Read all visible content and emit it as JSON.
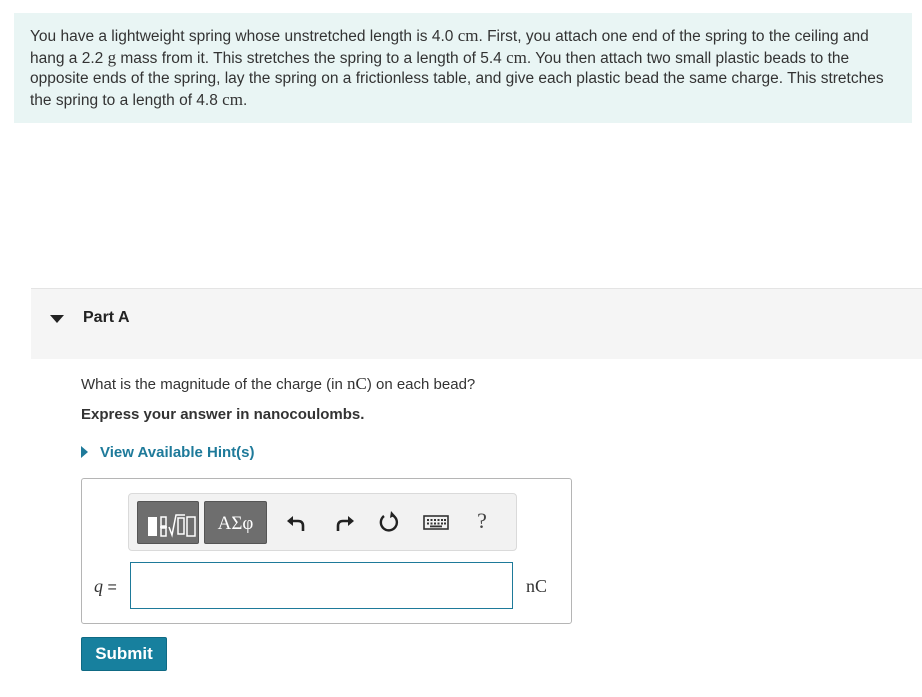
{
  "problem": {
    "s1": "You have a lightweight spring whose unstretched length is 4.0",
    "u1": "cm",
    "s2": ". First, you attach one end of the spring to the ceiling",
    "s3": "and hang a 2.2",
    "u2": "g",
    "s4": "mass from it. This stretches the spring to a length of 5.4",
    "u3": "cm",
    "s5": ". You then attach two small plastic beads",
    "s6": "to the opposite ends of the spring, lay the spring on a frictionless table, and give each plastic bead the same charge.",
    "s7": "This stretches the spring to a length of 4.8",
    "u4": "cm",
    "s8": "."
  },
  "part": {
    "title": "Part A",
    "question_pre": "What is the magnitude of the charge (in",
    "question_unit": "nC",
    "question_post": ") on each bead?",
    "instruction": "Express your answer in nanocoulombs.",
    "hint_label": "View Available Hint(s)"
  },
  "toolbar": {
    "greek_label": "ΑΣφ",
    "help_label": "?",
    "icons": [
      "templates-icon",
      "greek-symbols-icon",
      "undo-icon",
      "redo-icon",
      "reset-icon",
      "keyboard-icon",
      "help-icon"
    ]
  },
  "answer": {
    "variable": "q",
    "equals": "=",
    "value": "",
    "unit": "nC"
  },
  "submit_label": "Submit",
  "colors": {
    "accent": "#17809e",
    "problem_bg": "#e9f5f4",
    "link": "#1e7a9a"
  }
}
